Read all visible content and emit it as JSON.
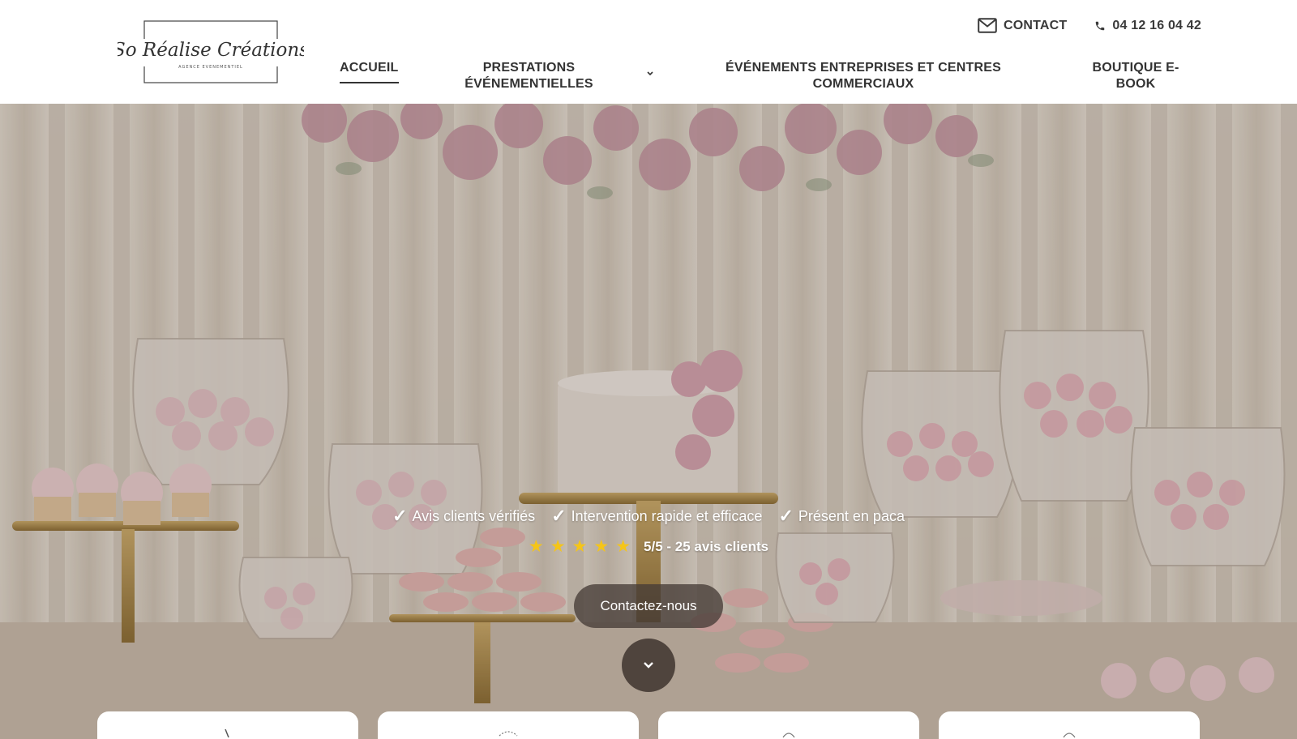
{
  "brand": {
    "logo_text": "So Réalise Créations",
    "logo_subtext": "AGENCE EVENEMENTIEL"
  },
  "topbar": {
    "contact_label": "CONTACT",
    "phone": "04 12 16 04 42"
  },
  "nav": {
    "accueil": "ACCUEIL",
    "prestations": "PRESTATIONS ÉVÉNEMENTIELLES",
    "evenements": "ÉVÉNEMENTS ENTREPRISES ET CENTRES COMMERCIAUX",
    "boutique": "BOUTIQUE E-BOOK"
  },
  "hero": {
    "features": [
      "Avis clients vérifiés",
      "Intervention rapide et efficace",
      "Présent en paca"
    ],
    "rating": {
      "stars": 5,
      "text": "5/5 - 25 avis clients"
    },
    "cta_label": "Contactez-nous"
  },
  "colors": {
    "star": "#f5c518",
    "nav_text": "#333333",
    "cta_bg": "#463c37"
  },
  "icons": {
    "contact": "mail-icon",
    "phone": "phone-icon",
    "dropdown": "chevron-down-icon",
    "check": "check-icon",
    "star": "star-icon",
    "scroll": "chevron-down-icon"
  }
}
